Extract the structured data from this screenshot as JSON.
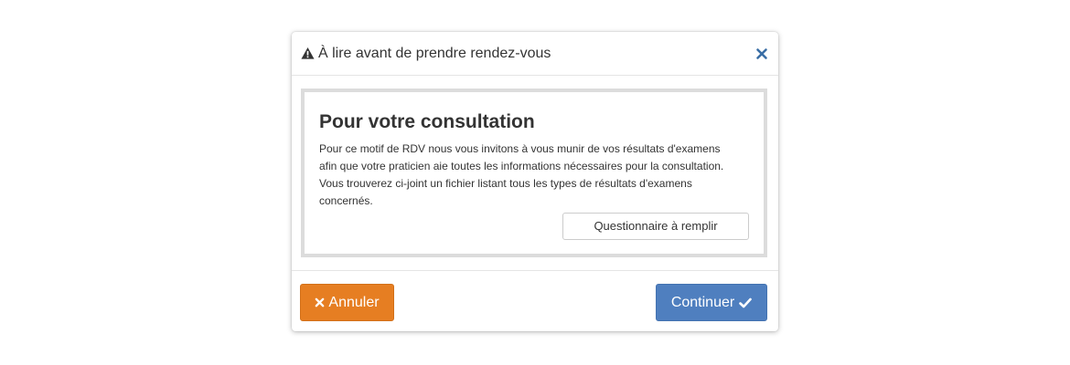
{
  "dialog": {
    "title": "À lire avant de prendre rendez-vous",
    "title_icon": "warning-triangle-icon",
    "close_icon": "close-icon"
  },
  "body": {
    "heading": "Pour votre consultation",
    "paragraph_lines": [
      "Pour ce motif de RDV nous vous invitons à vous munir de vos résultats d'examens",
      "afin que votre praticien aie toutes les informations nécessaires pour la consultation.",
      "Vous trouverez ci-joint un fichier listant tous les types de résultats d'examens",
      "concernés."
    ],
    "questionnaire_label": "Questionnaire à remplir"
  },
  "footer": {
    "cancel_label": "Annuler",
    "cancel_icon": "times-icon",
    "continue_label": "Continuer",
    "continue_icon": "check-icon"
  },
  "colors": {
    "cancel_bg": "#e67e22",
    "continue_bg": "#4f7fbf",
    "close_icon": "#3a6ea5",
    "body_border": "#dcdcdc"
  }
}
